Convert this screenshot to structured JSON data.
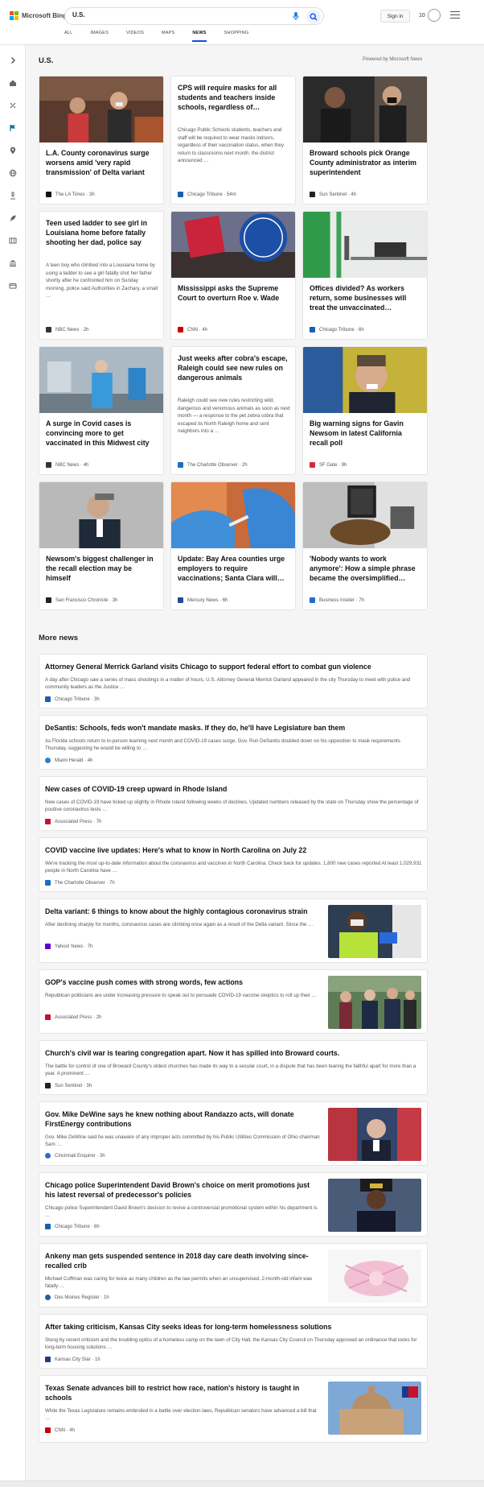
{
  "header": {
    "brand": "Microsoft Bing",
    "search_value": "U.S.",
    "sign_in": "Sign in",
    "rewards_count": "10",
    "tabs": [
      "ALL",
      "IMAGES",
      "VIDEOS",
      "MAPS",
      "NEWS",
      "SHOPPING"
    ],
    "active_tab": "NEWS"
  },
  "rail_icons": [
    "chevron-right-icon",
    "home-icon",
    "tools-icon",
    "flag-icon",
    "location-pin-icon",
    "globe-icon",
    "microscope-icon",
    "rocket-icon",
    "film-icon",
    "bank-icon",
    "card-icon"
  ],
  "top_section": {
    "title": "U.S.",
    "powered_by": "Powered by Microsoft News"
  },
  "cards": [
    {
      "title": "L.A. County coronavirus surge worsens amid 'very rapid transmission' of Delta variant",
      "source": "The LA Times",
      "age": "3h",
      "logo_color": "#111111"
    },
    {
      "title": "CPS will require masks for all students and teachers inside schools, regardless of…",
      "snippet": "Chicago Public Schools students, teachers and staff will be required to wear masks indoors, regardless of their vaccination status, when they return to classrooms next month, the district announced …",
      "source": "Chicago Tribune",
      "age": "54m",
      "logo_color": "#1a5fb4"
    },
    {
      "title": "Broward schools pick Orange County administrator as interim superintendent",
      "source": "Sun Sentinel",
      "age": "4h",
      "logo_color": "#222222"
    },
    {
      "title": "Teen used ladder to see girl in Louisiana home before fatally shooting her dad, police say",
      "snippet": "A teen boy who climbed into a Louisiana home by using a ladder to see a girl fatally shot her father shortly after he confronted him on Sunday morning, police said.Authorities in Zachary, a small …",
      "source": "NBC News",
      "age": "2h",
      "logo_color": "#333333"
    },
    {
      "title": "Mississippi asks the Supreme Court to overturn Roe v. Wade",
      "source": "CNN",
      "age": "4h",
      "logo_color": "#cc0000"
    },
    {
      "title": "Offices divided? As workers return, some businesses will treat the unvaccinated…",
      "source": "Chicago Tribune",
      "age": "6h",
      "logo_color": "#1a5fb4"
    },
    {
      "title": "A surge in Covid cases is convincing more to get vaccinated in this Midwest city",
      "source": "NBC News",
      "age": "4h",
      "logo_color": "#333333"
    },
    {
      "title": "Just weeks after cobra's escape, Raleigh could see new rules on dangerous animals",
      "snippet": "Raleigh could see new rules restricting wild, dangerous and venomous animals as soon as next month — a response to the pet zebra cobra that escaped its North Raleigh home and sent neighbors into a …",
      "source": "The Charlotte Observer",
      "age": "2h",
      "logo_color": "#1b6ec2"
    },
    {
      "title": "Big warning signs for Gavin Newsom in latest California recall poll",
      "source": "SF Gate",
      "age": "9h",
      "logo_color": "#d62b3b"
    },
    {
      "title": "Newsom's biggest challenger in the recall election may be himself",
      "source": "San Francisco Chronicle",
      "age": "3h",
      "logo_color": "#222222"
    },
    {
      "title": "Update: Bay Area counties urge employers to require vaccinations; Santa Clara will…",
      "source": "Mercury News",
      "age": "6h",
      "logo_color": "#244a8f"
    },
    {
      "title": "'Nobody wants to work anymore': How a simple phrase became the oversimplified…",
      "source": "Business Insider",
      "age": "7h",
      "logo_color": "#1f6ed4"
    }
  ],
  "more_news": {
    "title": "More news",
    "items": [
      {
        "title": "Attorney General Merrick Garland visits Chicago to support federal effort to combat gun violence",
        "snippet": "A day after Chicago saw a series of mass shootings in a matter of hours, U.S. Attorney General Merrick Garland appeared in the city Thursday to meet with police and community leaders as the Justice …",
        "source": "Chicago Tribune",
        "age": "3h",
        "logo_color": "#1a5fb4"
      },
      {
        "title": "DeSantis: Schools, feds won't mandate masks. If they do, he'll have Legislature ban them",
        "snippet": "As Florida schools return to in-person learning next month and COVID-19 cases surge, Gov. Ron DeSantis doubled down on his opposition to mask requirements Thursday, suggesting he would be willing to …",
        "source": "Miami Herald",
        "age": "4h",
        "logo_color": "#2a7fc9"
      },
      {
        "title": "New cases of COVID-19 creep upward in Rhode Island",
        "snippet": "New cases of COVID-19 have ticked up slightly in Rhode Island following weeks of declines. Updated numbers released by the state on Thursday show the percentage of positive coronavirus tests …",
        "source": "Associated Press",
        "age": "7h",
        "logo_color": "#c8102e"
      },
      {
        "title": "COVID vaccine live updates: Here's what to know in North Carolina on July 22",
        "snippet": "We're tracking the most up-to-date information about the coronavirus and vaccines in North Carolina. Check back for updates. 1,800 new cases reported At least 1,029,931 people in North Carolina have …",
        "source": "The Charlotte Observer",
        "age": "7h",
        "logo_color": "#1b6ec2"
      },
      {
        "title": "Delta variant: 6 things to know about the highly contagious coronavirus strain",
        "snippet": "After declining sharply for months, coronavirus cases are climbing once again as a result of the Delta variant. Since the …",
        "source": "Yahoo! News",
        "age": "7h",
        "logo_color": "#6001d2"
      },
      {
        "title": "GOP's vaccine push comes with strong words, few actions",
        "snippet": "Republican politicians are under increasing pressure to speak out to persuade COVID-19 vaccine skeptics to roll up their …",
        "source": "Associated Press",
        "age": "2h",
        "logo_color": "#c8102e"
      },
      {
        "title": "Church's civil war is tearing congregation apart. Now it has spilled into Broward courts.",
        "snippet": "The battle for control of one of Broward County's oldest churches has made its way to a secular court, in a dispute that has been tearing the faithful apart for more than a year. A prominent …",
        "source": "Sun Sentinel",
        "age": "3h",
        "logo_color": "#222222"
      },
      {
        "title": "Gov. Mike DeWine says he knew nothing about Randazzo acts, will donate FirstEnergy contributions",
        "snippet": "Gov. Mike DeWine said he was unaware of any improper acts committed by his Public Utilities Commission of Ohio chairman Sam …",
        "source": "Cincinnati Enquirer",
        "age": "3h",
        "logo_color": "#2a6cc9"
      },
      {
        "title": "Chicago police Superintendent David Brown's choice on merit promotions just his latest reversal of predecessor's policies",
        "snippet": "Chicago police Superintendent David Brown's decision to revive a controversial promotional system within his department is …",
        "source": "Chicago Tribune",
        "age": "6h",
        "logo_color": "#1a5fb4"
      },
      {
        "title": "Ankeny man gets suspended sentence in 2018 day care death involving since-recalled crib",
        "snippet": "Michael Coffman was caring for twice as many children as the law permits when an unsupervised, 2-month-old infant was fatally …",
        "source": "Des Moines Register",
        "age": "1h",
        "logo_color": "#2a5aa8"
      },
      {
        "title": "After taking criticism, Kansas City seeks ideas for long-term homelessness solutions",
        "snippet": "Stung by recent criticism and the troubling optics of a homeless camp on the lawn of City Hall, the Kansas City Council on Thursday approved an ordinance that looks for long-term housing solutions …",
        "source": "Kansas City Star",
        "age": "1h",
        "logo_color": "#1c3f7a"
      },
      {
        "title": "Texas Senate advances bill to restrict how race, nation's history is taught in schools",
        "snippet": "While the Texas Legislature remains embroiled in a battle over election laws, Republican senators have advanced a bill that …",
        "source": "CNN",
        "age": "4h",
        "logo_color": "#cc0000"
      }
    ]
  }
}
